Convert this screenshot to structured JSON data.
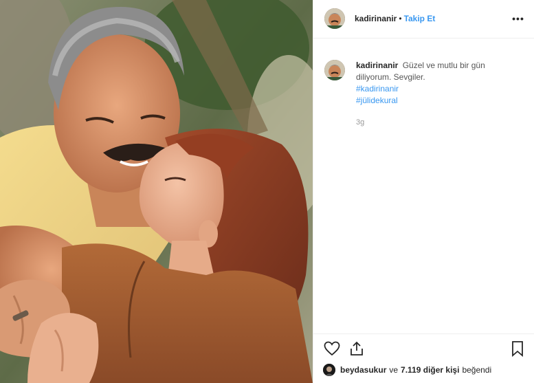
{
  "post": {
    "photo": {
      "icon": "couple-photo"
    },
    "header": {
      "username": "kadirinanir",
      "separator": "•",
      "follow_label": "Takip Et",
      "more_icon": "more-options-icon"
    },
    "caption": {
      "username": "kadirinanir",
      "text": "Güzel ve mutlu bir gün diliyorum. Sevgiler.",
      "hashtags": [
        "#kadirinanir",
        "#jülidekural"
      ]
    },
    "time_ago": "3g",
    "actions": {
      "like_icon": "heart-icon",
      "share_icon": "share-icon",
      "save_icon": "bookmark-icon"
    },
    "likes": {
      "first_liker": "beydasukur",
      "connector": "ve",
      "others_count": "7.119 diğer kişi",
      "suffix": "beğendi"
    },
    "colors": {
      "link": "#3897f0",
      "text": "#262626",
      "muted": "#999999",
      "border": "#efefef"
    }
  }
}
